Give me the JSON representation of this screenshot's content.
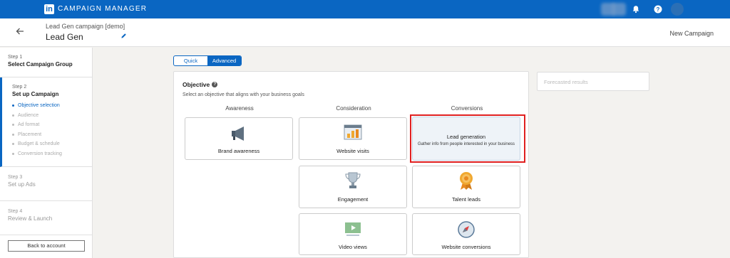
{
  "topnav": {
    "brand_logo": "in",
    "brand_text": "CAMPAIGN MANAGER",
    "icons": [
      "bell-icon",
      "help-icon"
    ]
  },
  "header": {
    "campaign_group": "Lead Gen campaign [demo]",
    "campaign_name": "Lead Gen",
    "new_campaign": "New Campaign"
  },
  "sidebar": {
    "step1": {
      "num": "Step 1",
      "title": "Select Campaign Group"
    },
    "step2": {
      "num": "Step 2",
      "title": "Set up Campaign",
      "items": [
        "Objective selection",
        "Audience",
        "Ad format",
        "Placement",
        "Budget & schedule",
        "Conversion tracking"
      ]
    },
    "step3": {
      "num": "Step 3",
      "title": "Set up Ads"
    },
    "step4": {
      "num": "Step 4",
      "title": "Review & Launch"
    },
    "back_button": "Back to account"
  },
  "toggle": {
    "quick": "Quick",
    "advanced": "Advanced",
    "selected": "Advanced"
  },
  "objective": {
    "title": "Objective",
    "subtitle": "Select an objective that aligns with your business goals",
    "columns": [
      "Awareness",
      "Consideration",
      "Conversions"
    ],
    "cards": {
      "brand_awareness": "Brand awareness",
      "website_visits": "Website visits",
      "lead_generation": "Lead generation",
      "lead_generation_desc": "Gather info from people interested in your business",
      "engagement": "Engagement",
      "talent_leads": "Talent leads",
      "video_views": "Video views",
      "website_conversions": "Website conversions"
    }
  },
  "forecast": {
    "title": "Forecasted results"
  },
  "colors": {
    "brand": "#0a66c2",
    "highlight": "#e02020",
    "selected_card": "#eef3f8"
  }
}
